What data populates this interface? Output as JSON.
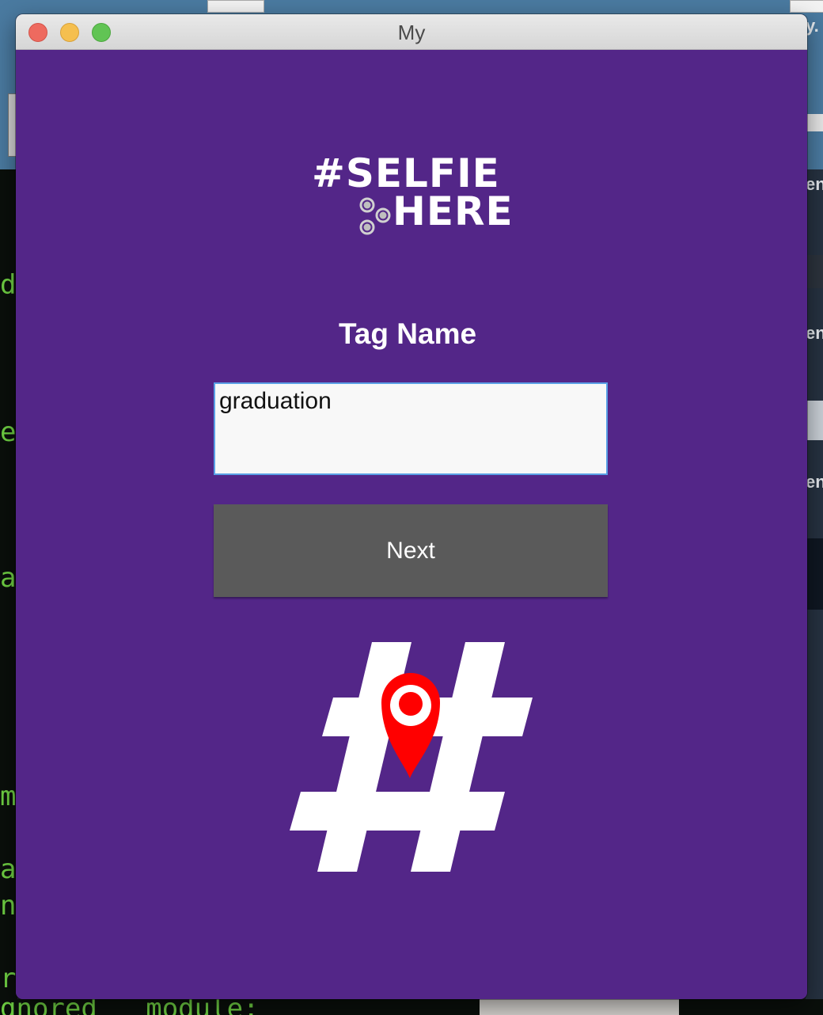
{
  "window": {
    "title": "My"
  },
  "logo": {
    "line1": "#SELFIE",
    "line2": "HERE"
  },
  "form": {
    "heading": "Tag Name",
    "input_value": "graduation",
    "next_label": "Next"
  },
  "colors": {
    "app_background": "#532688",
    "button_background": "#5a5a5a",
    "input_border": "#5aa0e6",
    "pin": "#ff0000"
  },
  "desktop": {
    "terminal_left_chars": [
      "d",
      "e",
      "a",
      "m",
      "a",
      "n",
      "r"
    ],
    "terminal_bottom_text": "gnored   module:",
    "right_window_snippets": [
      "y.",
      "en",
      "en",
      "en"
    ]
  },
  "icons": {
    "logo_dots": "three-circle-dots-icon",
    "hash_location": "hashtag-location-pin-icon"
  }
}
